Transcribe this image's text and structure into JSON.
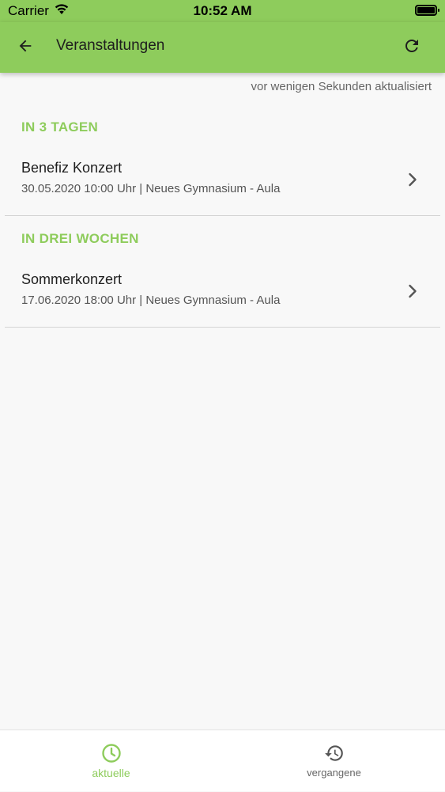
{
  "status_bar": {
    "carrier": "Carrier",
    "time": "10:52 AM",
    "wifi_icon": "wifi-icon",
    "battery_icon": "battery-icon"
  },
  "app_bar": {
    "title": "Veranstaltungen",
    "back_icon": "arrow-left-icon",
    "refresh_icon": "refresh-icon"
  },
  "content": {
    "last_updated": "vor wenigen Sekunden aktualisiert",
    "sections": [
      {
        "header": "IN 3 TAGEN",
        "events": [
          {
            "title": "Benefiz Konzert",
            "details": "30.05.2020 10:00 Uhr | Neues Gymnasium - Aula"
          }
        ]
      },
      {
        "header": "IN DREI WOCHEN",
        "events": [
          {
            "title": "Sommerkonzert",
            "details": "17.06.2020 18:00 Uhr | Neues Gymnasium - Aula"
          }
        ]
      }
    ]
  },
  "bottom_nav": {
    "items": [
      {
        "label": "aktuelle",
        "icon": "clock-icon",
        "active": true
      },
      {
        "label": "vergangene",
        "icon": "history-icon",
        "active": false
      }
    ]
  },
  "colors": {
    "accent": "#8ecc5c",
    "background": "#f8f8f8",
    "text_primary": "#1e1e1e",
    "text_secondary": "#555555"
  }
}
